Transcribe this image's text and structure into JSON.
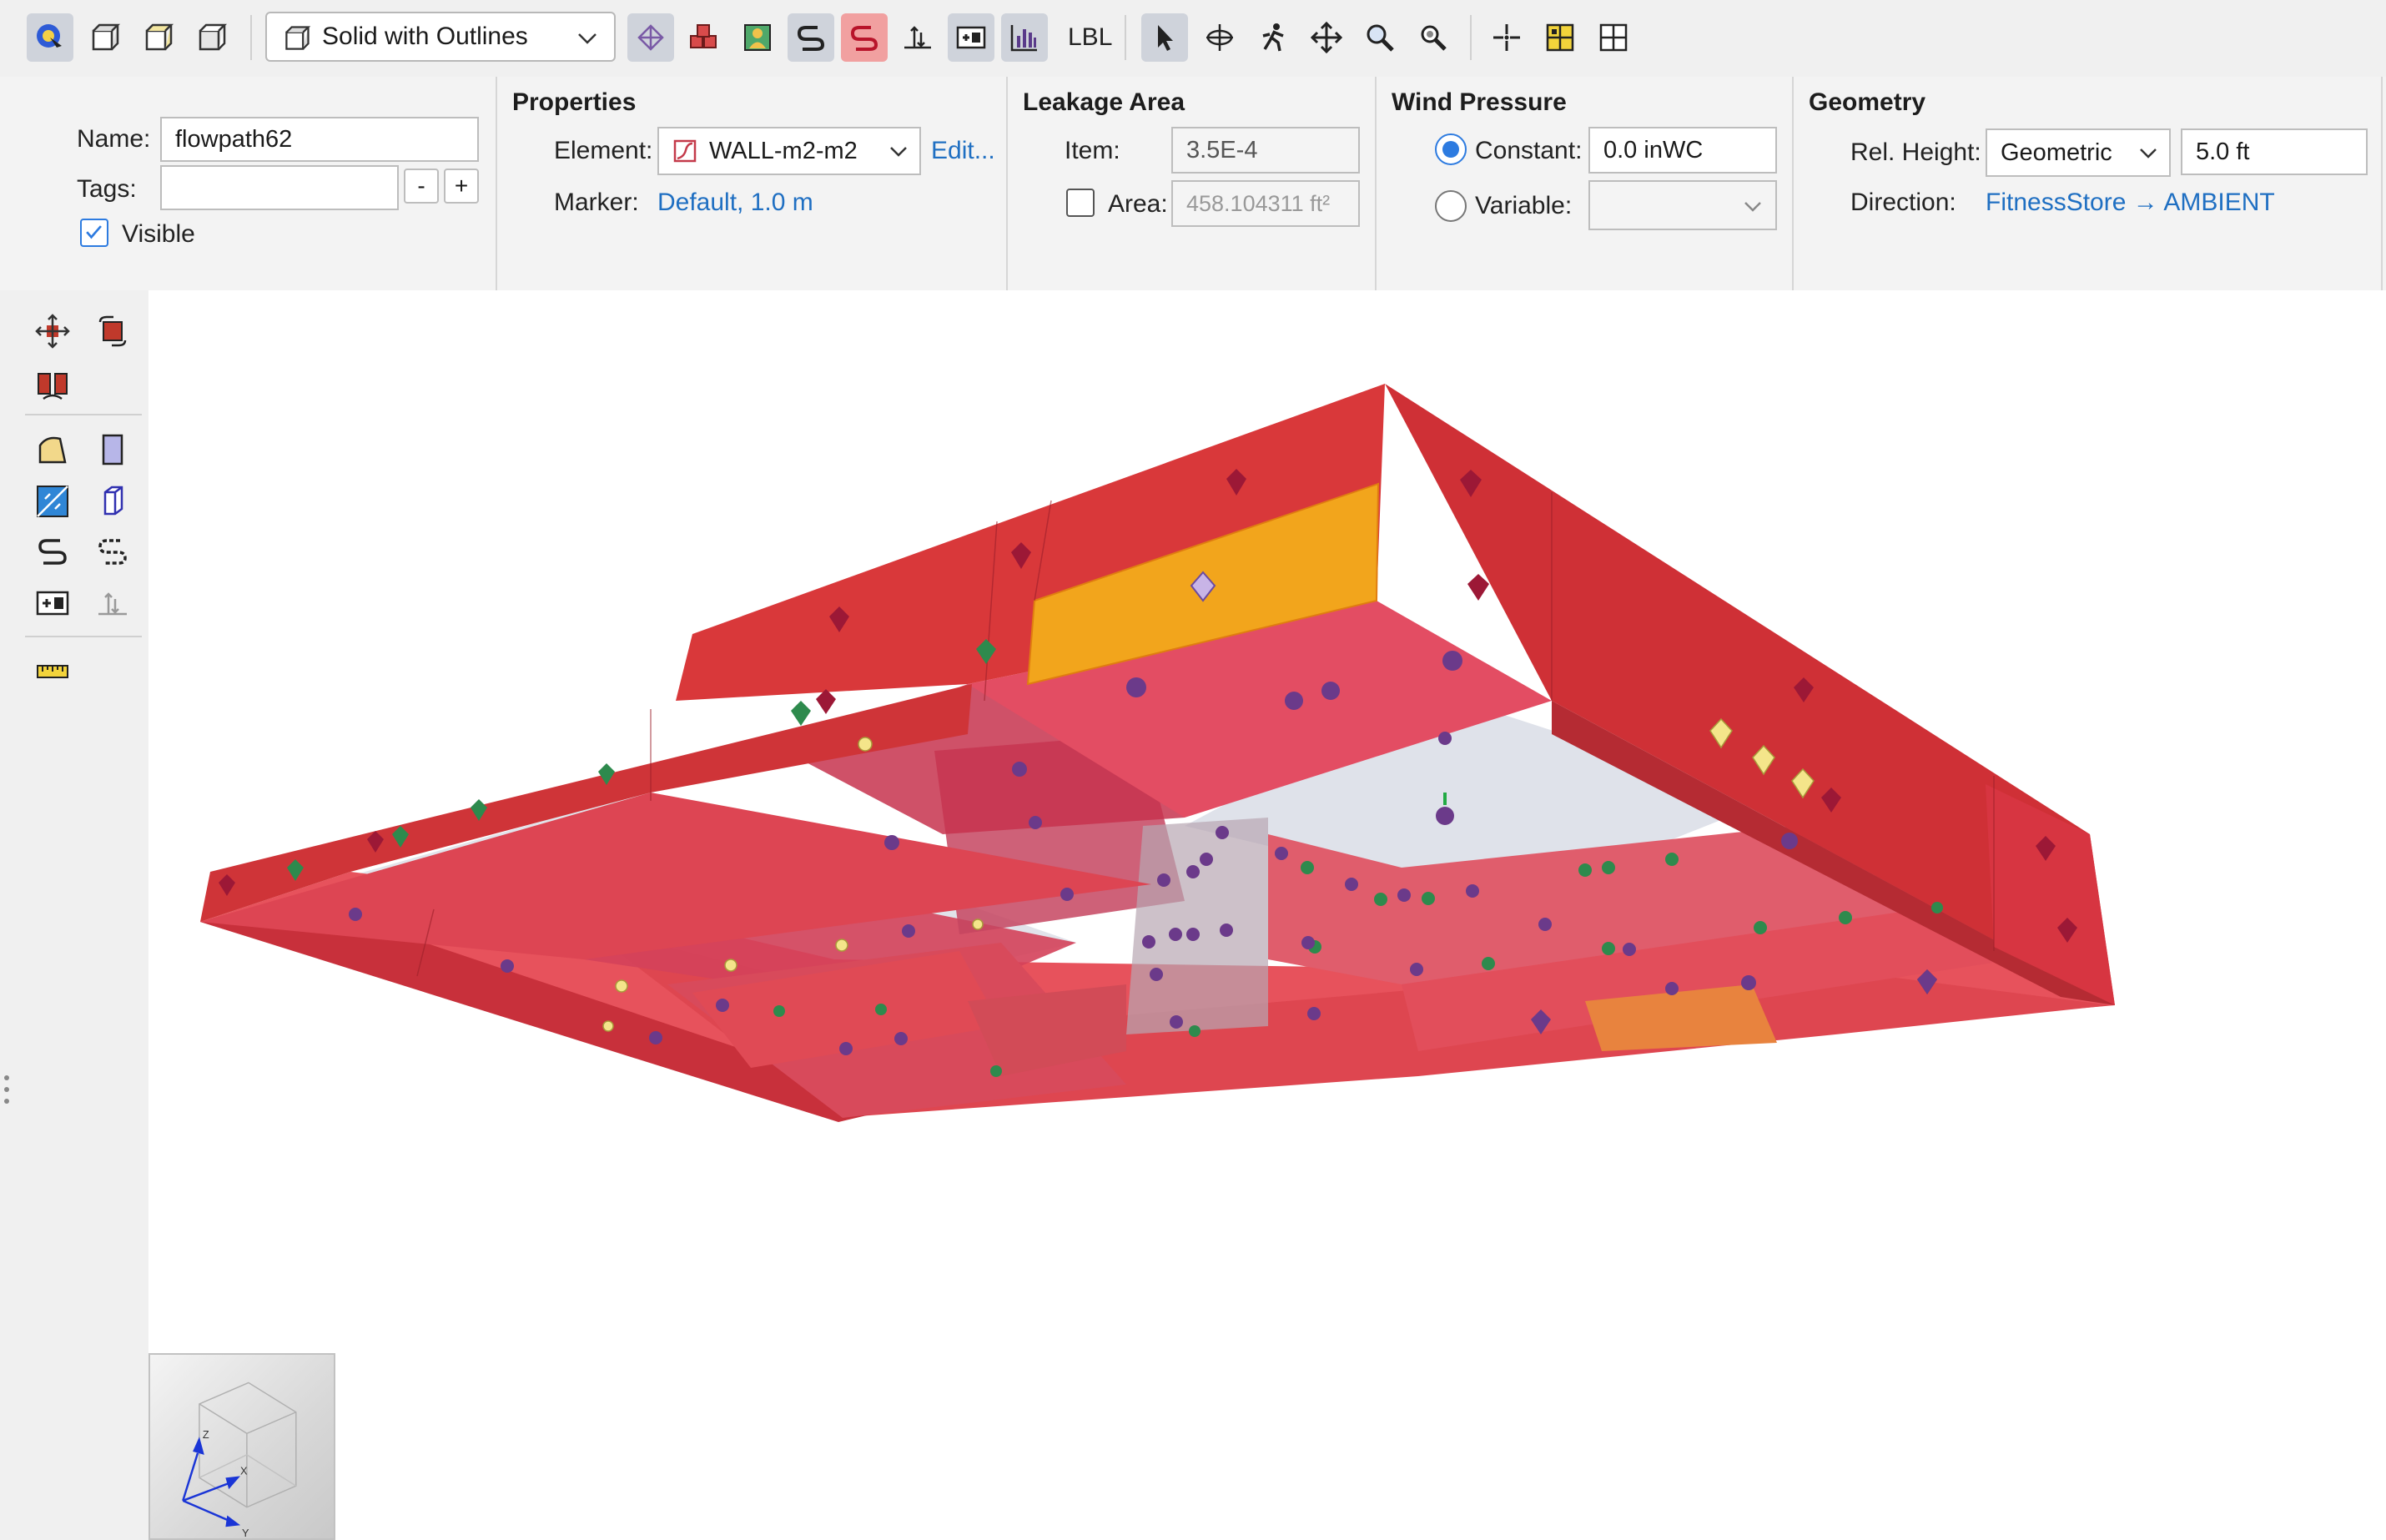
{
  "toolbar": {
    "render_mode": "Solid with Outlines",
    "lbl": "LBL"
  },
  "name_section": {
    "name_label": "Name:",
    "name_value": "flowpath62",
    "tags_label": "Tags:",
    "tags_value": "",
    "minus": "-",
    "plus": "+",
    "visible_label": "Visible",
    "visible_checked": true
  },
  "properties": {
    "title": "Properties",
    "element_label": "Element:",
    "element_value": "WALL-m2-m2",
    "edit_link": "Edit...",
    "marker_label": "Marker:",
    "marker_value": "Default, 1.0 m"
  },
  "leakage": {
    "title": "Leakage Area",
    "item_label": "Item:",
    "item_value": "3.5E-4",
    "area_label": "Area:",
    "area_value": "458.104311 ft²",
    "area_checked": false
  },
  "wind": {
    "title": "Wind Pressure",
    "constant_label": "Constant:",
    "constant_value": "0.0 inWC",
    "variable_label": "Variable:",
    "variable_value": "",
    "selected": "constant"
  },
  "geometry": {
    "title": "Geometry",
    "rel_height_label": "Rel. Height:",
    "rel_height_mode": "Geometric",
    "rel_height_value": "5.0 ft",
    "direction_label": "Direction:",
    "direction_value": "FitnessStore → AMBIENT"
  },
  "axes": {
    "z": "Z",
    "x": "X",
    "y": "Y"
  },
  "colors": {
    "accent": "#2d7be0",
    "link": "#1f6fc2",
    "wall_red": "#d8353f",
    "highlight_orange": "#f2a51c"
  }
}
